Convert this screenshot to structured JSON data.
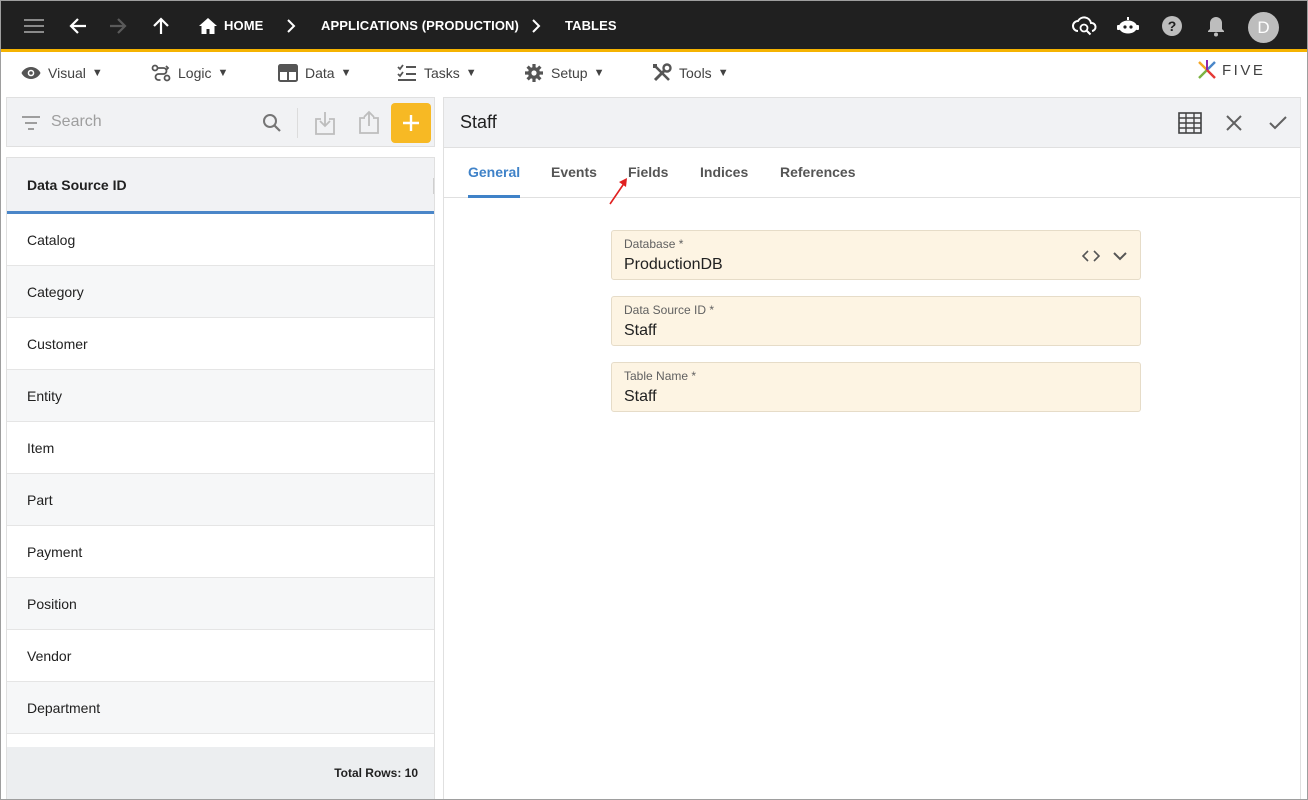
{
  "topbar": {
    "breadcrumbs": [
      "HOME",
      "APPLICATIONS (PRODUCTION)",
      "TABLES"
    ],
    "avatar_initial": "D",
    "background_color": "#202020",
    "accent_color": "#f5b301"
  },
  "menubar": {
    "items": [
      {
        "label": "Visual",
        "icon": "eye-icon"
      },
      {
        "label": "Logic",
        "icon": "flow-icon"
      },
      {
        "label": "Data",
        "icon": "table-icon"
      },
      {
        "label": "Tasks",
        "icon": "checklist-icon"
      },
      {
        "label": "Setup",
        "icon": "gear-icon"
      },
      {
        "label": "Tools",
        "icon": "tools-icon"
      }
    ],
    "caret": "▼",
    "logo_text": "FIVE"
  },
  "left_panel": {
    "search_placeholder": "Search",
    "column_header": "Data Source ID",
    "rows": [
      "Catalog",
      "Category",
      "Customer",
      "Entity",
      "Item",
      "Part",
      "Payment",
      "Position",
      "Vendor",
      "Department"
    ],
    "footer": "Total Rows: 10",
    "add_button_color": "#f7b924"
  },
  "form": {
    "title": "Staff",
    "tabs": [
      "General",
      "Events",
      "Fields",
      "Indices",
      "References"
    ],
    "active_tab": "General",
    "active_tab_color": "#3f82c8",
    "fields": [
      {
        "label": "Database *",
        "value": "ProductionDB"
      },
      {
        "label": "Data Source ID *",
        "value": "Staff"
      },
      {
        "label": "Table Name *",
        "value": "Staff"
      }
    ],
    "field_background": "#fdf4e3"
  }
}
